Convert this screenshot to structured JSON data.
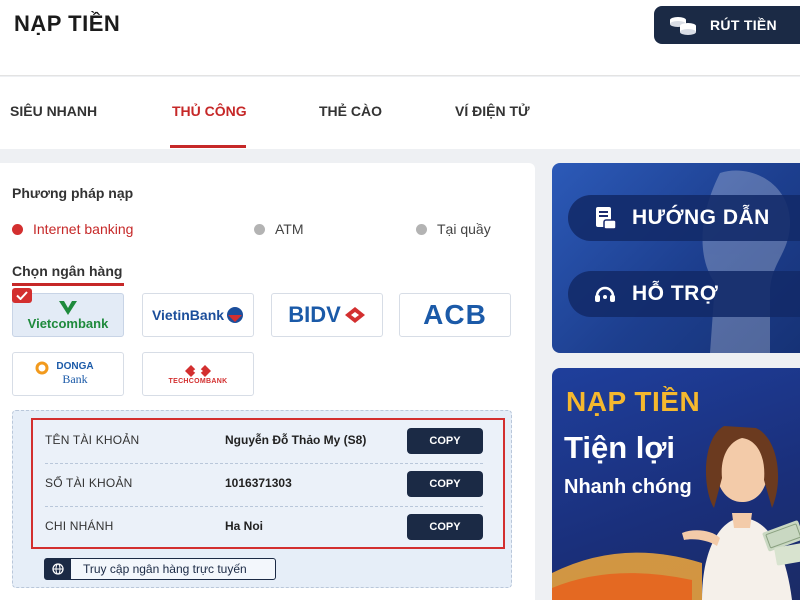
{
  "header": {
    "title": "NẠP TIỀN",
    "withdraw_label": "RÚT TIỀN"
  },
  "tabs": [
    {
      "label": "SIÊU NHANH",
      "active": false
    },
    {
      "label": "THỦ CÔNG",
      "active": true
    },
    {
      "label": "THẺ CÀO",
      "active": false
    },
    {
      "label": "VÍ ĐIỆN TỬ",
      "active": false
    }
  ],
  "deposit": {
    "method_title": "Phương pháp nạp",
    "methods": [
      {
        "label": "Internet banking",
        "selected": true
      },
      {
        "label": "ATM",
        "selected": false
      },
      {
        "label": "Tại quầy",
        "selected": false
      }
    ],
    "bank_title": "Chọn ngân hàng",
    "banks": [
      {
        "name": "Vietcombank",
        "selected": true
      },
      {
        "name": "VietinBank",
        "selected": false
      },
      {
        "name": "BIDV",
        "selected": false
      },
      {
        "name": "ACB",
        "selected": false
      },
      {
        "name": "DONGA",
        "name2": "Bank",
        "selected": false
      },
      {
        "name": "TECHCOMBANK",
        "selected": false
      }
    ]
  },
  "account": {
    "rows": [
      {
        "label": "TÊN TÀI KHOẢN",
        "value": "Nguyễn Đỗ Thảo My (S8)",
        "copy": "COPY"
      },
      {
        "label": "SỐ TÀI KHOẢN",
        "value": "1016371303",
        "copy": "COPY"
      },
      {
        "label": "CHI NHÁNH",
        "value": "Ha Noi",
        "copy": "COPY"
      }
    ],
    "online_link": "Truy cập ngân hàng trực tuyến"
  },
  "side": {
    "guide_label": "HƯỚNG DẪN",
    "support_label": "HỖ TRỢ"
  },
  "promo": {
    "line1": "NẠP TIỀN",
    "line2": "Tiện lợi",
    "line3": "Nhanh chóng"
  },
  "colors": {
    "accent": "#c62828",
    "navy": "#1b2a45",
    "panel_blue": "#1d3f8f",
    "gold": "#f5b82e"
  }
}
